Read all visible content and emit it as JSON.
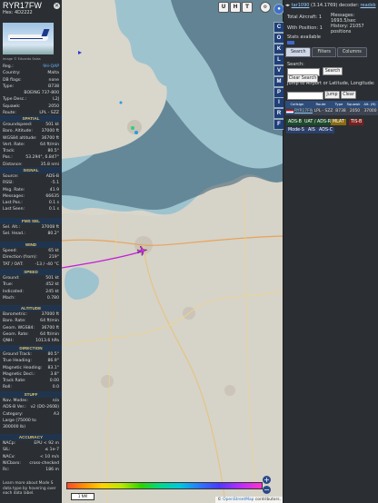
{
  "left": {
    "callsign": "RYR17FW",
    "hex_label": "Hex: 4D2222",
    "photo_credit": "Image © Eduardo Salas",
    "rows1": [
      {
        "k": "Reg.:",
        "v": "9H-QAP",
        "link": true
      },
      {
        "k": "Country:",
        "v": "Malta"
      },
      {
        "k": "DB flags:",
        "v": "none"
      },
      {
        "k": "Type:",
        "v": "B738"
      },
      {
        "k": "",
        "v": "BOEING 737-800"
      },
      {
        "k": "Type Desc.:",
        "v": "L2J"
      },
      {
        "k": "Squawk:",
        "v": "2050"
      },
      {
        "k": "Route:",
        "v": "LPL - SZZ"
      }
    ],
    "sections": [
      {
        "title": "SPATIAL",
        "rows": [
          {
            "k": "Groundspeed:",
            "v": "501 kt"
          },
          {
            "k": "Baro. Altitude:",
            "v": "37000 ft"
          },
          {
            "k": "WGS84 altitude:",
            "v": "36700 ft"
          },
          {
            "k": "Vert. Rate:",
            "v": "64 ft/min"
          },
          {
            "k": "Track:",
            "v": "80.5°"
          },
          {
            "k": "Pos.:",
            "v": "53.294°, 6.847°"
          },
          {
            "k": "Distance:",
            "v": "35.8 nmi"
          }
        ]
      },
      {
        "title": "SIGNAL",
        "rows": [
          {
            "k": "Source:",
            "v": "ADS-B"
          },
          {
            "k": "RSSI:",
            "v": "-5.1"
          },
          {
            "k": "Msg. Rate:",
            "v": "41.9"
          },
          {
            "k": "Messages:",
            "v": "66635"
          },
          {
            "k": "Last Pos.:",
            "v": "0.1 s"
          },
          {
            "k": "Last Seen:",
            "v": "0.1 s"
          }
        ]
      },
      {
        "title": "FMS SEL",
        "rows": [
          {
            "k": "Sel. Alt.:",
            "v": "37008 ft"
          },
          {
            "k": "Sel. Head.:",
            "v": "80.2°"
          }
        ]
      },
      {
        "title": "WIND",
        "rows": [
          {
            "k": "Speed:",
            "v": "65 kt"
          },
          {
            "k": "Direction (from):",
            "v": "219°"
          },
          {
            "k": "TAT / OAT:",
            "v": "-13 / -40 °C"
          }
        ]
      },
      {
        "title": "SPEED",
        "rows": [
          {
            "k": "Ground:",
            "v": "501 kt"
          },
          {
            "k": "True:",
            "v": "452 kt"
          },
          {
            "k": "Indicated:",
            "v": "245 kt"
          },
          {
            "k": "Mach:",
            "v": "0.780"
          }
        ]
      },
      {
        "title": "ALTITUDE",
        "rows": [
          {
            "k": "Barometric:",
            "v": "37000 ft"
          },
          {
            "k": "Baro. Rate:",
            "v": "64 ft/min"
          },
          {
            "k": "Geom. WGS84:",
            "v": "36700 ft"
          },
          {
            "k": "Geom. Rate:",
            "v": "64 ft/min"
          },
          {
            "k": "QNH:",
            "v": "1013.6 hPa"
          }
        ]
      },
      {
        "title": "DIRECTION",
        "rows": [
          {
            "k": "Ground Track:",
            "v": "80.5°"
          },
          {
            "k": "True Heading:",
            "v": "86.9°"
          },
          {
            "k": "Magnetic Heading:",
            "v": "83.1°"
          },
          {
            "k": "Magnetic Decl.:",
            "v": "3.8°"
          },
          {
            "k": "Track Rate:",
            "v": "0.00"
          },
          {
            "k": "Roll:",
            "v": "0.0"
          }
        ]
      },
      {
        "title": "STUFF",
        "rows": [
          {
            "k": "Nav. Modes:",
            "v": "n/a"
          },
          {
            "k": "ADS-B Ver.:",
            "v": "v2 (DO-260B)"
          },
          {
            "k": "Category:",
            "v": "A3"
          },
          {
            "k": "Large (75000 to",
            "v": ""
          },
          {
            "k": "300000 lb)",
            "v": ""
          }
        ]
      },
      {
        "title": "ACCURACY",
        "rows": [
          {
            "k": "NACp:",
            "v": "EPU < 92 m"
          },
          {
            "k": "SIL:",
            "v": "≤ 1e-7"
          },
          {
            "k": "NACv:",
            "v": "< 10 m/s"
          },
          {
            "k": "NICbaro:",
            "v": "cross-checked"
          },
          {
            "k": "Rc:",
            "v": "186 m"
          }
        ]
      }
    ],
    "footer_note": "Learn more about Mode S data type by hovering over each data label."
  },
  "map": {
    "top_buttons": [
      "U",
      "H",
      "T"
    ],
    "zoom_in": "+",
    "zoom_out": "−",
    "scale_label": "1 NM",
    "attribution_prefix": "©",
    "attribution_link": "OpenStreetMap",
    "attribution_suffix": "contributors."
  },
  "strip": {
    "buttons": [
      "C",
      "O",
      "K",
      "L",
      "V",
      "M",
      "P",
      "I",
      "R",
      "F"
    ]
  },
  "right": {
    "app_link": "tar1090",
    "version": "(3.14.1769)",
    "decoder_text": "decoder:",
    "decoder_link": "readsb",
    "total_aircraft_label": "Total Aircraft:",
    "total_aircraft": "1",
    "messages_label": "Messages:",
    "messages_value": "1693.5/sec",
    "with_position_label": "With Position:",
    "with_position": "1",
    "history_label": "History:",
    "history_value": "21057 positions",
    "stats_label": "Stats available",
    "tabs": [
      "Search",
      "Filters",
      "Columns"
    ],
    "search_label": "Search:",
    "search_button": "Search",
    "clear_button": "Clear Search",
    "jump_label": "Jump to Airport or Latitude, Longitude:",
    "jump_button": "Jump",
    "clear2_button": "Clear",
    "table_headers": [
      "Callsign",
      "Route",
      "Type",
      "Squawk",
      "Alt. (ft)"
    ],
    "table_row": {
      "callsign": "RYR17FW",
      "route": "LPL - SZZ",
      "type": "B738",
      "squawk": "2050",
      "alt": "37000"
    },
    "legend": [
      {
        "label": "ADS-B",
        "color": "#1d4b2b"
      },
      {
        "label": "UAT / ADS-R",
        "color": "#1d4b2b"
      },
      {
        "label": "MLAT",
        "color": "#8a6a12"
      },
      {
        "label": "TIS-B",
        "color": "#7a1f1f"
      },
      {
        "label": "Mode-S",
        "color": "#2b3f6a"
      },
      {
        "label": "AIS",
        "color": "#2b3f6a"
      },
      {
        "label": "ADS-C",
        "color": "#2b3f6a"
      }
    ]
  }
}
